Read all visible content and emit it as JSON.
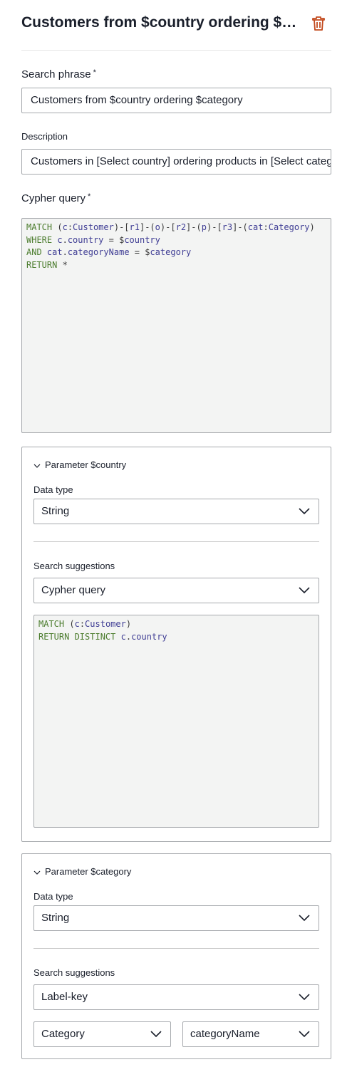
{
  "header": {
    "title": "Customers from $country ordering $category"
  },
  "fields": {
    "search_phrase_label": "Search phrase",
    "search_phrase_value": "Customers from $country ordering $category",
    "description_label": "Description",
    "description_value": "Customers in [Select country] ordering products in [Select category]",
    "cypher_label": "Cypher query",
    "required_mark": "*"
  },
  "main_query": {
    "lines": [
      [
        {
          "t": "kw",
          "v": "MATCH"
        },
        {
          "t": "pu",
          "v": " ("
        },
        {
          "t": "id",
          "v": "c"
        },
        {
          "t": "pu",
          "v": ":"
        },
        {
          "t": "id",
          "v": "Customer"
        },
        {
          "t": "pu",
          "v": ")-["
        },
        {
          "t": "id",
          "v": "r1"
        },
        {
          "t": "pu",
          "v": "]-("
        },
        {
          "t": "id",
          "v": "o"
        },
        {
          "t": "pu",
          "v": ")-["
        },
        {
          "t": "id",
          "v": "r2"
        },
        {
          "t": "pu",
          "v": "]-("
        },
        {
          "t": "id",
          "v": "p"
        },
        {
          "t": "pu",
          "v": ")-["
        },
        {
          "t": "id",
          "v": "r3"
        },
        {
          "t": "pu",
          "v": "]-("
        },
        {
          "t": "id",
          "v": "cat"
        },
        {
          "t": "pu",
          "v": ":"
        },
        {
          "t": "id",
          "v": "Category"
        },
        {
          "t": "pu",
          "v": ")"
        }
      ],
      [
        {
          "t": "kw",
          "v": "WHERE"
        },
        {
          "t": "pu",
          "v": " "
        },
        {
          "t": "id",
          "v": "c"
        },
        {
          "t": "pu",
          "v": "."
        },
        {
          "t": "id",
          "v": "country"
        },
        {
          "t": "pu",
          "v": " = $"
        },
        {
          "t": "id",
          "v": "country"
        }
      ],
      [
        {
          "t": "kw",
          "v": "AND"
        },
        {
          "t": "pu",
          "v": " "
        },
        {
          "t": "id",
          "v": "cat"
        },
        {
          "t": "pu",
          "v": "."
        },
        {
          "t": "id",
          "v": "categoryName"
        },
        {
          "t": "pu",
          "v": " = $"
        },
        {
          "t": "id",
          "v": "category"
        }
      ],
      [
        {
          "t": "kw",
          "v": "RETURN"
        },
        {
          "t": "pu",
          "v": " *"
        }
      ]
    ]
  },
  "param_country": {
    "title": "Parameter $country",
    "data_type_label": "Data type",
    "data_type_value": "String",
    "suggestions_label": "Search suggestions",
    "suggestions_value": "Cypher query",
    "query_lines": [
      [
        {
          "t": "kw",
          "v": "MATCH"
        },
        {
          "t": "pu",
          "v": " ("
        },
        {
          "t": "id",
          "v": "c"
        },
        {
          "t": "pu",
          "v": ":"
        },
        {
          "t": "id",
          "v": "Customer"
        },
        {
          "t": "pu",
          "v": ")"
        }
      ],
      [
        {
          "t": "kw",
          "v": "RETURN DISTINCT"
        },
        {
          "t": "pu",
          "v": " "
        },
        {
          "t": "id",
          "v": "c"
        },
        {
          "t": "pu",
          "v": "."
        },
        {
          "t": "id",
          "v": "country"
        }
      ]
    ]
  },
  "param_category": {
    "title": "Parameter $category",
    "data_type_label": "Data type",
    "data_type_value": "String",
    "suggestions_label": "Search suggestions",
    "suggestions_value": "Label-key",
    "label_value": "Category",
    "key_value": "categoryName"
  },
  "icons": {
    "delete": "trash-icon",
    "collapse": "chevron-down-icon",
    "dropdown": "chevron-down-icon"
  },
  "colors": {
    "delete": "#c2491d",
    "keyword": "#4b7c2d",
    "identifier": "#3f3d94",
    "code_bg": "#f3f4f3"
  }
}
